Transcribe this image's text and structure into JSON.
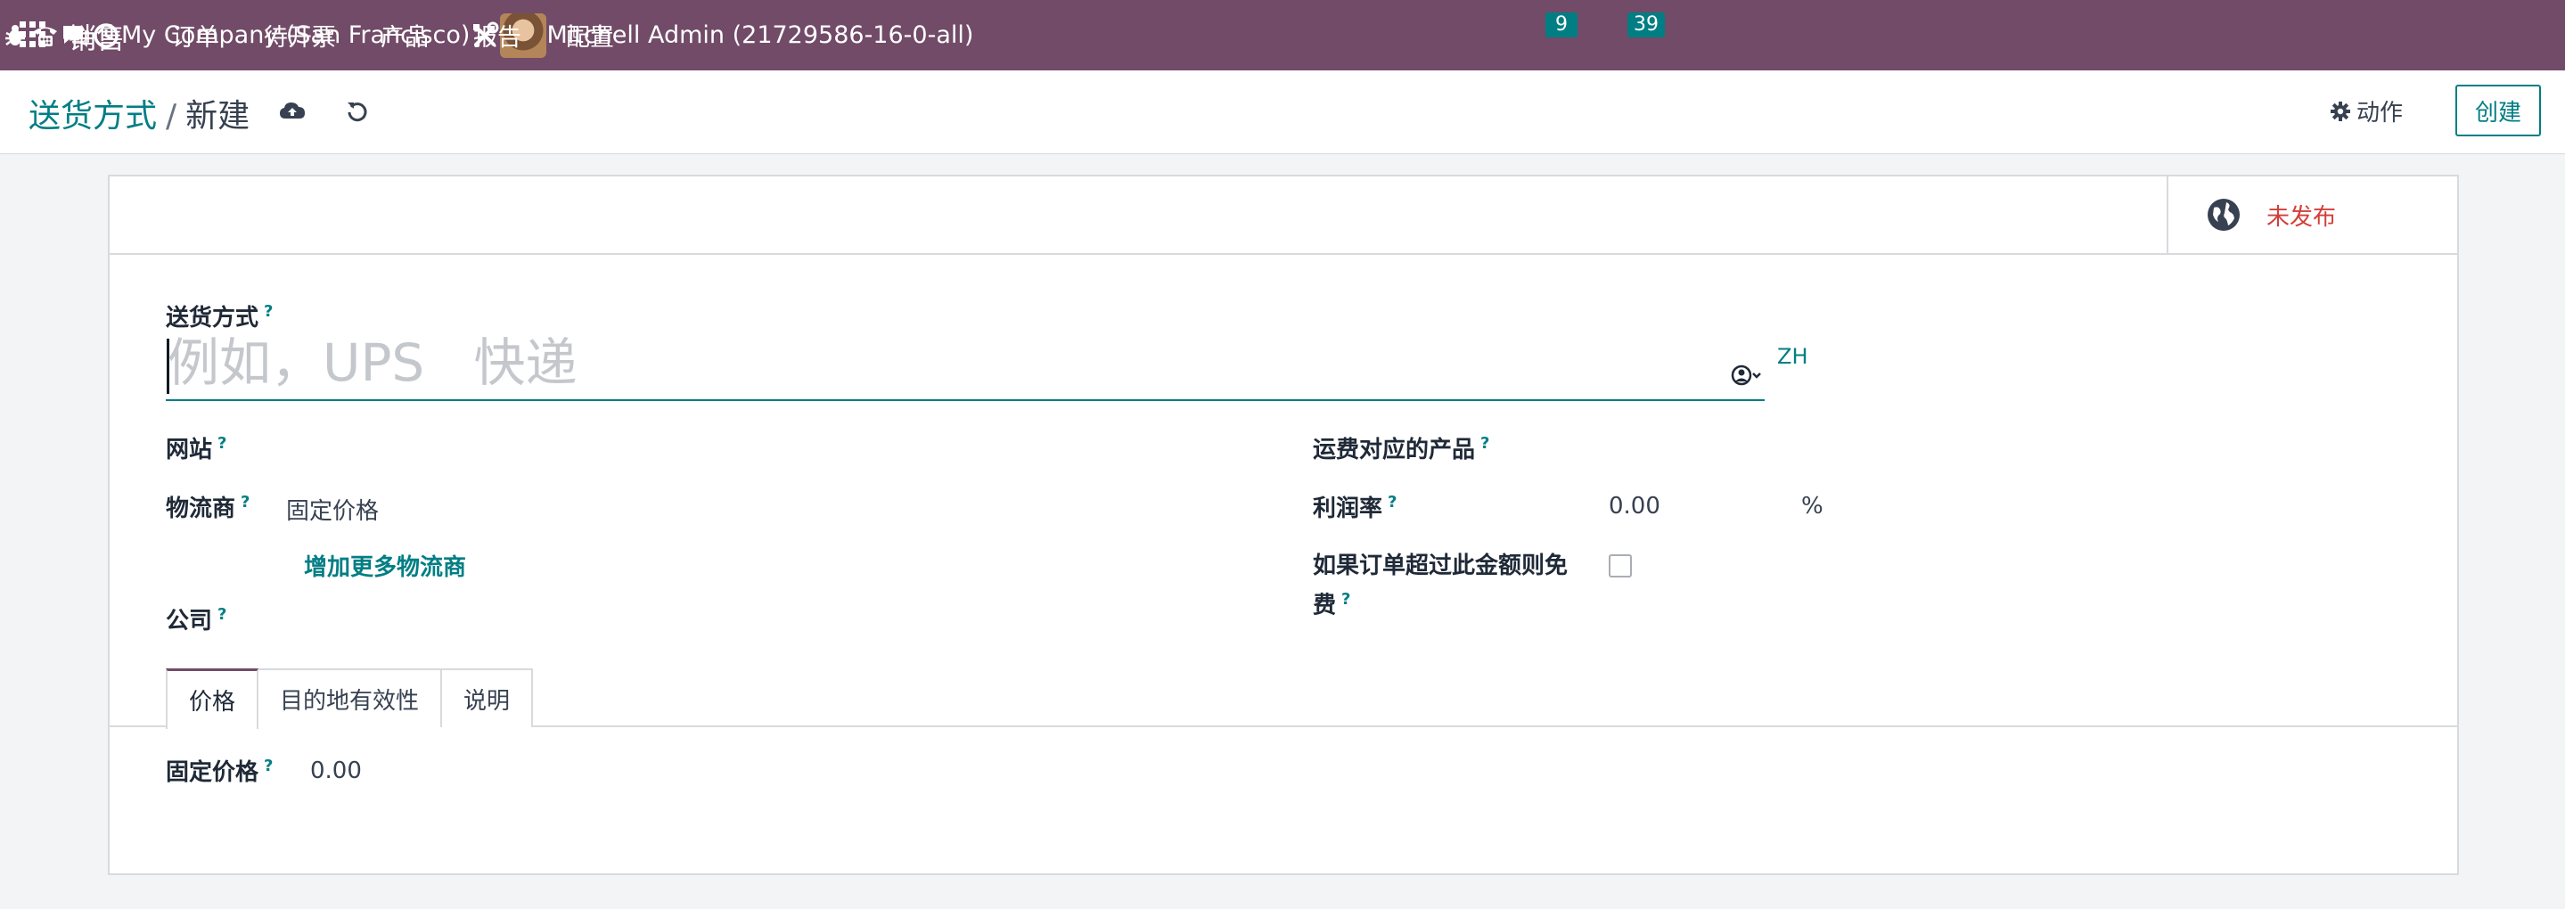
{
  "navbar": {
    "app_name": "销售",
    "menu": [
      "订单",
      "待开票",
      "产品",
      "报告",
      "配置"
    ],
    "messages_count": "9",
    "activities_count": "39",
    "company": "My Company (San Francisco)",
    "user": "Mitchell Admin (21729586-16-0-all)",
    "icons": [
      "apps-grid-icon",
      "bug-icon",
      "phone-icon",
      "chat-icon",
      "clock-icon",
      "tools-icon"
    ]
  },
  "control_panel": {
    "breadcrumb_parent": "送货方式",
    "breadcrumb_separator": "/",
    "breadcrumb_current": "新建",
    "action_label": "动作",
    "create_label": "创建"
  },
  "form": {
    "publish_status": "未发布",
    "name_label": "送货方式",
    "name_placeholder": "例如，UPS   快递",
    "name_value": "",
    "lang_code": "ZH",
    "website_label": "网站",
    "provider_label": "物流商",
    "provider_value": "固定价格",
    "add_providers_label": "增加更多物流商",
    "company_label": "公司",
    "delivery_product_label": "运费对应的产品",
    "margin_label": "利润率",
    "margin_value": "0.00",
    "margin_unit": "%",
    "free_over_label_line1": "如果订单超过此金额则免",
    "free_over_label_line2": "费",
    "free_over_checked": false,
    "tabs": [
      "价格",
      "目的地有效性",
      "说明"
    ],
    "active_tab": "价格",
    "fixed_price_label": "固定价格",
    "fixed_price_value": "0.00",
    "help_mark": "?"
  },
  "colors": {
    "navbar": "#714b67",
    "accent": "#017e84",
    "unpublished": "#d23f3a",
    "background": "#f3f4f6"
  }
}
